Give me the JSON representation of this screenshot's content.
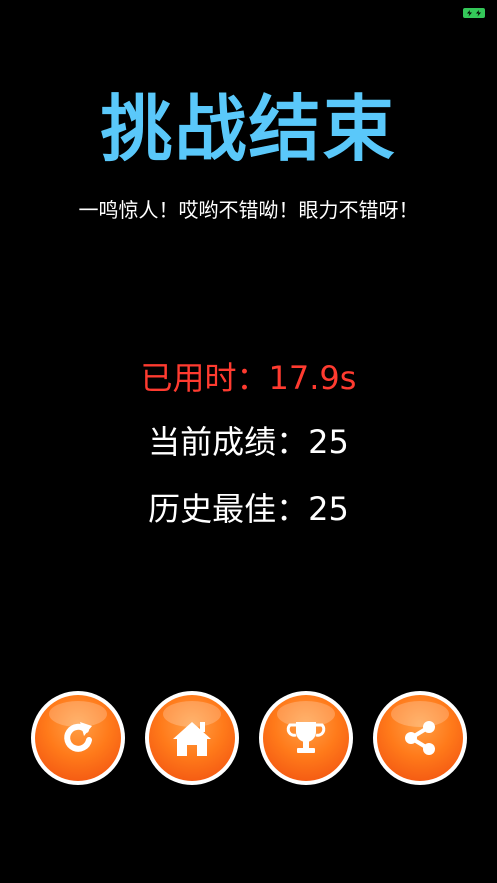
{
  "title": "挑战结束",
  "subtitle": "一鸣惊人！哎哟不错呦！眼力不错呀！",
  "stats": {
    "time_text": "已用时：17.9s",
    "current_text": "当前成绩：25",
    "best_text": "历史最佳：25"
  },
  "buttons": [
    {
      "icon": "restart-icon"
    },
    {
      "icon": "home-icon"
    },
    {
      "icon": "trophy-icon"
    },
    {
      "icon": "share-icon"
    }
  ],
  "colors": {
    "title": "#5ac8fa",
    "time": "#ff3b30",
    "button": "#ff7a1a",
    "battery": "#34c759"
  }
}
